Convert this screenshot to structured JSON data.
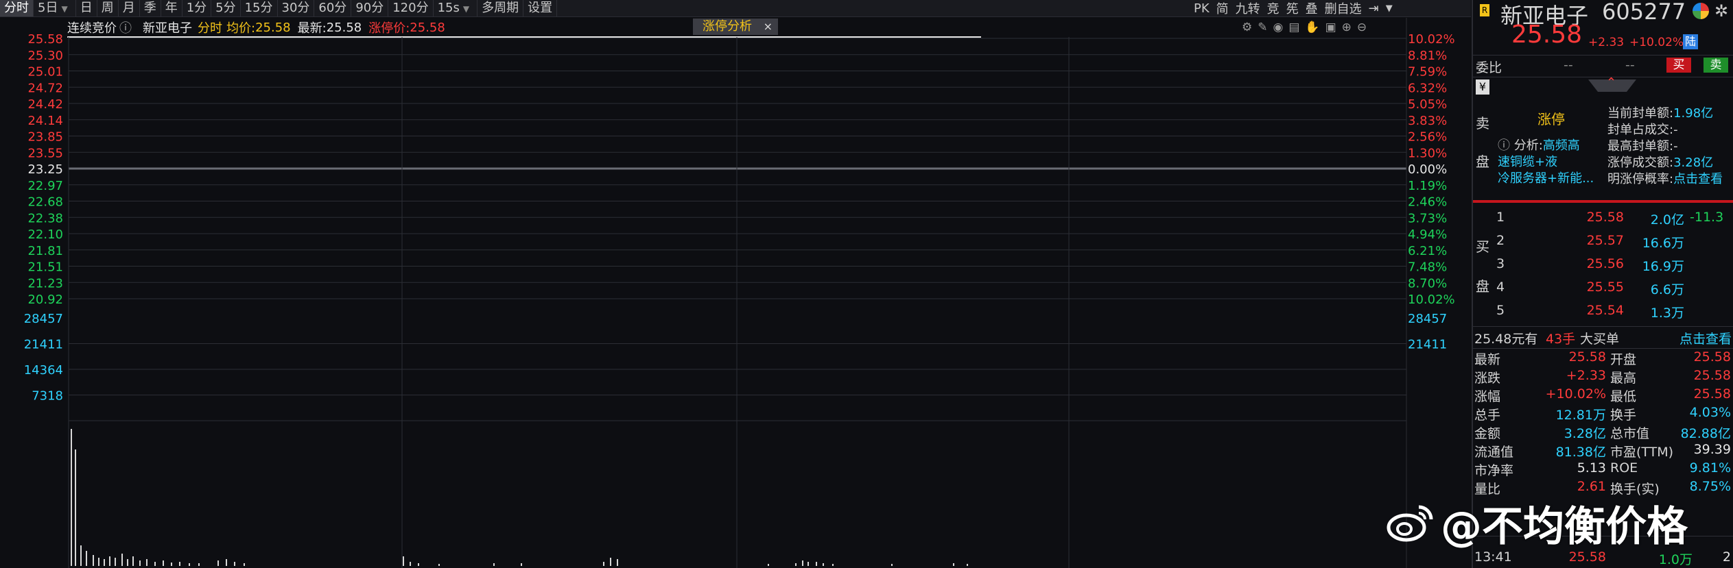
{
  "toolbar": {
    "items": [
      "分时",
      "5日",
      "日",
      "周",
      "月",
      "季",
      "年",
      "1分",
      "5分",
      "15分",
      "30分",
      "60分",
      "90分",
      "120分",
      "15s",
      "多周期",
      "设置"
    ],
    "right": [
      "PK",
      "简",
      "九转",
      "竞",
      "筅",
      "叠",
      "删自选"
    ]
  },
  "infobar": {
    "auction": "连续竞价",
    "info_icon": "ⓘ",
    "name": "新亚电子",
    "mode": "分时",
    "avg_label": "均价:",
    "avg_value": "25.58",
    "last_label": "最新:",
    "last_value": "25.58",
    "limit_label": "涨停价:",
    "limit_value": "25.58",
    "tab": "涨停分析",
    "tab_close": "×"
  },
  "axes": {
    "price_left": [
      "25.58",
      "25.30",
      "25.01",
      "24.72",
      "24.42",
      "24.14",
      "23.85",
      "23.55",
      "23.25",
      "22.97",
      "22.68",
      "22.38",
      "22.10",
      "21.81",
      "21.51",
      "21.23",
      "20.92"
    ],
    "pct_right": [
      "10.02%",
      "8.81%",
      "7.59%",
      "6.32%",
      "5.05%",
      "3.83%",
      "2.56%",
      "1.30%",
      "0.00%",
      "1.19%",
      "2.46%",
      "3.73%",
      "4.94%",
      "6.21%",
      "7.48%",
      "8.70%",
      "10.02%"
    ],
    "volume_left": [
      "28457",
      "21411",
      "14364",
      "7318"
    ],
    "volume_right": [
      "28457",
      "21411"
    ]
  },
  "colors": {
    "up": "#ff3b3b",
    "down": "#1ed35a",
    "cyan": "#2fd2ff",
    "yellow": "#f3c319",
    "bg": "#0d0e12",
    "grid": "#2c2e35"
  },
  "panel": {
    "name": "新亚电子",
    "code": "605277",
    "price": "25.58",
    "change": "+2.33",
    "pct": "+10.02%",
    "badge": "陆",
    "weibi_label": "委比",
    "weibi_v1": "--",
    "weibi_v2": "--",
    "buy_btn": "买",
    "sell_btn": "卖",
    "yen": "¥",
    "sell_side": [
      "卖",
      "盘"
    ],
    "zt_title": "涨停",
    "analysis_prefix": "分析:",
    "analysis_lines": [
      "高频高",
      "速铜缆+液",
      "冷服务器+新能..."
    ],
    "seal_stats": [
      {
        "label": "当前封单额:",
        "value": "1.98亿"
      },
      {
        "label": "封单占成交:",
        "value": "-"
      },
      {
        "label": "最高封单额:",
        "value": "-"
      },
      {
        "label": "涨停成交额:",
        "value": "3.28亿"
      },
      {
        "label": "明涨停概率:",
        "value": "点击查看"
      }
    ],
    "buy_side": [
      "买",
      "盘"
    ],
    "bids": [
      {
        "level": "1",
        "price": "25.58",
        "vol": "2.0亿",
        "chg": "-11.3"
      },
      {
        "level": "2",
        "price": "25.57",
        "vol": "16.6万",
        "chg": ""
      },
      {
        "level": "3",
        "price": "25.56",
        "vol": "16.9万",
        "chg": ""
      },
      {
        "level": "4",
        "price": "25.55",
        "vol": "6.6万",
        "chg": ""
      },
      {
        "level": "5",
        "price": "25.54",
        "vol": "1.3万",
        "chg": ""
      }
    ],
    "bigorder_price": "25.48元有",
    "bigorder_qty": "43手",
    "bigorder_label": "大买单",
    "bigorder_link": "点击查看",
    "quotes": [
      {
        "l1": "最新",
        "v1": "25.58",
        "c1": "red",
        "l2": "开盘",
        "v2": "25.58",
        "c2": "red"
      },
      {
        "l1": "涨跌",
        "v1": "+2.33",
        "c1": "red",
        "l2": "最高",
        "v2": "25.58",
        "c2": "red"
      },
      {
        "l1": "涨幅",
        "v1": "+10.02%",
        "c1": "red",
        "l2": "最低",
        "v2": "25.58",
        "c2": "red"
      },
      {
        "l1": "总手",
        "v1": "12.81万",
        "c1": "cyan",
        "l2": "换手",
        "v2": "4.03%",
        "c2": "cyan"
      },
      {
        "l1": "金额",
        "v1": "3.28亿",
        "c1": "cyan",
        "l2": "总市值",
        "v2": "82.88亿",
        "c2": "cyan"
      },
      {
        "l1": "流通值",
        "v1": "81.38亿",
        "c1": "cyan",
        "l2": "市盈(TTM)",
        "v2": "39.39",
        "c2": "white"
      },
      {
        "l1": "市净率",
        "v1": "5.13",
        "c1": "white",
        "l2": "ROE",
        "v2": "9.81%",
        "c2": "cyan"
      },
      {
        "l1": "量比",
        "v1": "2.61",
        "c1": "red",
        "l2": "换手(实)",
        "v2": "8.75%",
        "c2": "cyan"
      }
    ],
    "ticks": [
      {
        "time": "13:41",
        "price": "25.58",
        "vol": "1.0万",
        "n": "2"
      }
    ]
  },
  "watermark": "@不均衡价格"
}
